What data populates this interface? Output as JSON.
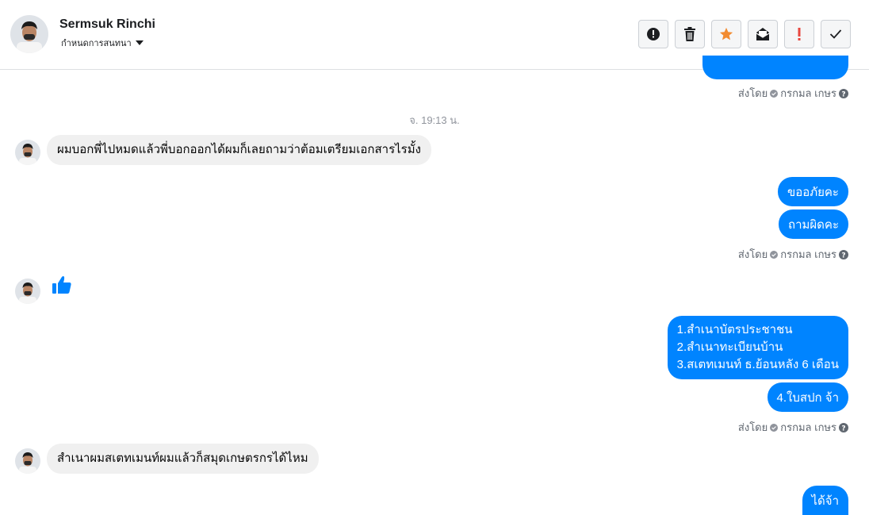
{
  "header": {
    "name": "Sermsuk Rinchi",
    "subtitle": "กำหนดการสนทนา"
  },
  "toolbar": {
    "buttons": [
      {
        "icon": "alert-circle-icon",
        "color": "#1c1e21"
      },
      {
        "icon": "trash-icon",
        "color": "#1c1e21"
      },
      {
        "icon": "star-icon",
        "color": "#f28b30"
      },
      {
        "icon": "mail-icon",
        "color": "#1c1e21"
      },
      {
        "icon": "exclamation-icon",
        "color": "#e8473f"
      },
      {
        "icon": "check-icon",
        "color": "#1c1e21"
      }
    ]
  },
  "sent_by": {
    "prefix": "ส่งโดย",
    "name": "กรกมล เกษร"
  },
  "timestamp": "จ. 19:13 น.",
  "messages": {
    "m1": "ผมบอกพี่ไปหมดแล้วพี่บอกออกได้ผมก็เลยถามว่าต้อมเตรียมเอกสารไรมั้ง",
    "m2": "ขออภัยคะ",
    "m3": "ถามผิดคะ",
    "m4_lines": [
      "1.สำเนาบัตรประชาชน",
      "2.สำเนาทะเบียนบ้าน",
      "3.สเตทเมนท์ ธ.ย้อนหลัง 6 เดือน"
    ],
    "m5": "4.ใบสปก จ้า",
    "m6": "สำเนาผมสเตทเมนท์ผมแล้วก็สมุดเกษตรกรได้ไหม",
    "m7": "ได้จ้า"
  },
  "colors": {
    "outgoing": "#0084ff",
    "incoming": "#f0f0f0",
    "meta": "#606770"
  }
}
